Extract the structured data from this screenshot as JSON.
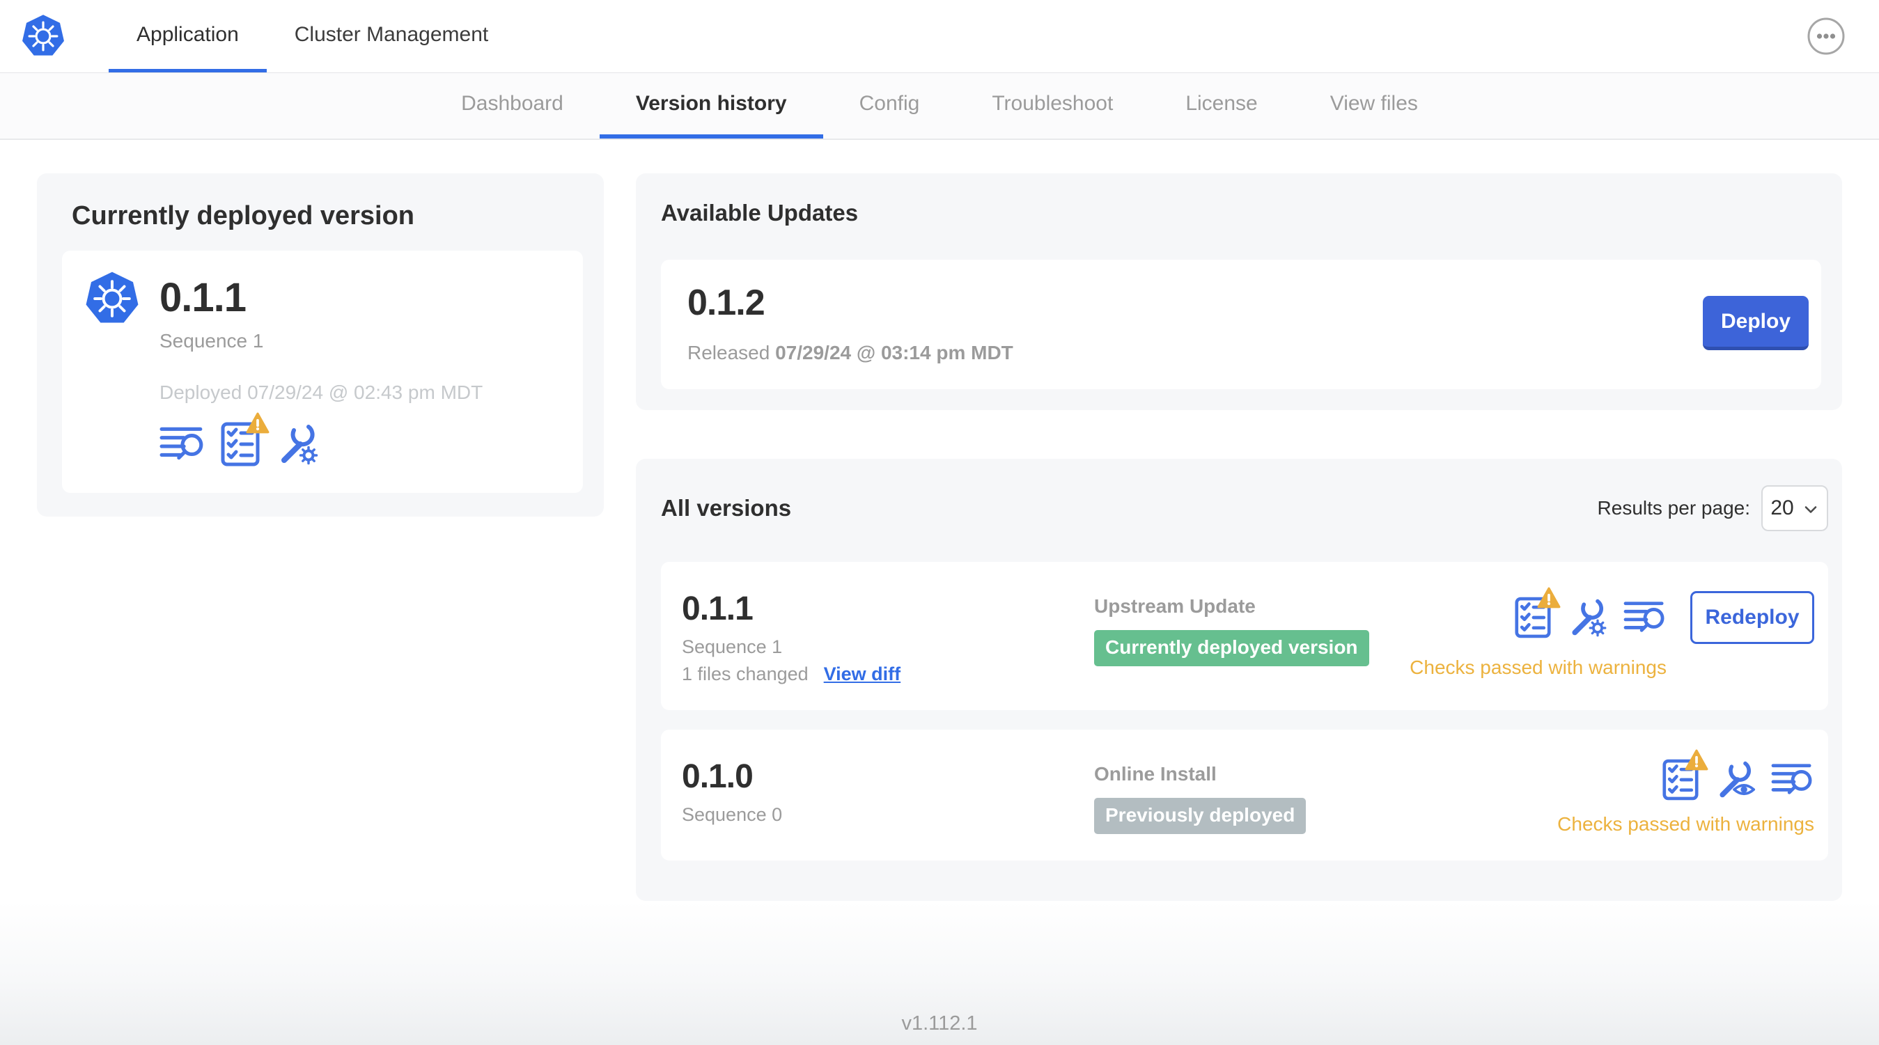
{
  "header": {
    "tabs": [
      {
        "label": "Application",
        "active": true
      },
      {
        "label": "Cluster Management",
        "active": false
      }
    ]
  },
  "subnav": {
    "tabs": [
      {
        "label": "Dashboard",
        "active": false
      },
      {
        "label": "Version history",
        "active": true
      },
      {
        "label": "Config",
        "active": false
      },
      {
        "label": "Troubleshoot",
        "active": false
      },
      {
        "label": "License",
        "active": false
      },
      {
        "label": "View files",
        "active": false
      }
    ]
  },
  "deployed": {
    "title": "Currently deployed version",
    "version": "0.1.1",
    "sequence": "Sequence 1",
    "deployed_at": "Deployed 07/29/24 @ 02:43 pm MDT",
    "icons": [
      "deploy-logs-icon",
      "preflight-checks-warning-icon",
      "edit-config-icon"
    ]
  },
  "updates": {
    "title": "Available Updates",
    "version": "0.1.2",
    "released_prefix": "Released",
    "released_date": "07/29/24 @ 03:14 pm MDT",
    "deploy_label": "Deploy"
  },
  "versions": {
    "title": "All versions",
    "results_per_page_label": "Results per page:",
    "results_per_page": "20",
    "rows": [
      {
        "version": "0.1.1",
        "sequence": "Sequence 1",
        "files_changed": "1 files changed",
        "diff_link": "View diff",
        "source": "Upstream Update",
        "badge": "Currently deployed version",
        "badge_color": "#66BF8F",
        "icons": [
          "preflight-checks-warning-icon",
          "edit-config-icon",
          "deploy-logs-icon"
        ],
        "status": "Checks passed with warnings",
        "action": "Redeploy"
      },
      {
        "version": "0.1.0",
        "sequence": "Sequence 0",
        "source": "Online Install",
        "badge": "Previously deployed",
        "badge_color": "#B3BDC1",
        "icons": [
          "preflight-checks-warning-icon",
          "view-config-icon",
          "deploy-logs-icon"
        ],
        "status": "Checks passed with warnings"
      }
    ]
  },
  "footer": {
    "version": "v1.112.1"
  },
  "colors": {
    "accent_blue": "#326DE6",
    "button_blue": "#3D64D9",
    "icon_blue": "#4574E4",
    "warning_amber": "#ECB23E",
    "badge_green": "#66BF8F",
    "badge_gray": "#B3BDC1",
    "panel_gray": "#F6F7F9"
  }
}
